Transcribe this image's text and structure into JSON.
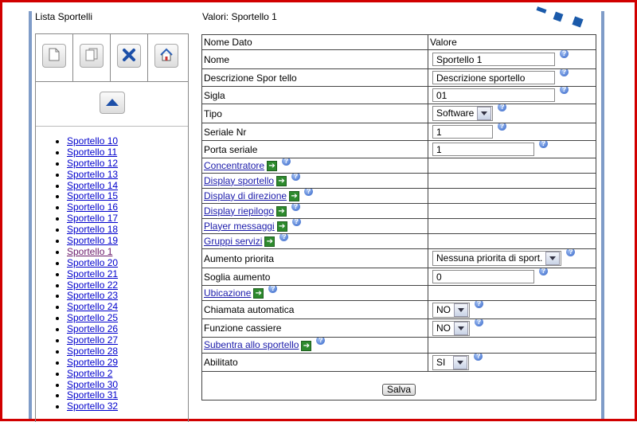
{
  "header": {
    "left_title": "Lista Sportelli",
    "right_title": "Valori: Sportello 1"
  },
  "toolbar": {
    "icons": [
      "new-document-icon",
      "copy-icon",
      "delete-icon",
      "home-icon"
    ]
  },
  "list": {
    "items": [
      "Sportello 10",
      "Sportello 11",
      "Sportello 12",
      "Sportello 13",
      "Sportello 14",
      "Sportello 15",
      "Sportello 16",
      "Sportello 17",
      "Sportello 18",
      "Sportello 19",
      "Sportello 1",
      "Sportello 20",
      "Sportello 21",
      "Sportello 22",
      "Sportello 23",
      "Sportello 24",
      "Sportello 25",
      "Sportello 26",
      "Sportello 27",
      "Sportello 28",
      "Sportello 29",
      "Sportello 2",
      "Sportello 30",
      "Sportello 31",
      "Sportello 32"
    ]
  },
  "table": {
    "col_name": "Nome Dato",
    "col_value": "Valore",
    "rows": {
      "nome": {
        "label": "Nome",
        "value": "Sportello 1"
      },
      "descrizione": {
        "label": "Descrizione Spor tello",
        "value": "Descrizione sportello"
      },
      "sigla": {
        "label": "Sigla",
        "value": "01"
      },
      "tipo": {
        "label": "Tipo",
        "value": "Software"
      },
      "seriale": {
        "label": "Seriale Nr",
        "value": "1"
      },
      "porta": {
        "label": "Porta seriale",
        "value": "1"
      },
      "concentratore": {
        "label": "Concentratore"
      },
      "display_sportello": {
        "label": "Display sportello"
      },
      "display_direzione": {
        "label": "Display di direzione"
      },
      "display_riepilogo": {
        "label": "Display riepilogo"
      },
      "player": {
        "label": "Player messaggi"
      },
      "gruppi": {
        "label": "Gruppi servizi"
      },
      "aumento": {
        "label": "Aumento priorita",
        "value": "Nessuna priorita di sport."
      },
      "soglia": {
        "label": "Soglia aumento",
        "value": "0"
      },
      "ubicazione": {
        "label": "Ubicazione"
      },
      "chiamata": {
        "label": "Chiamata automatica",
        "value": "NO"
      },
      "cassiere": {
        "label": "Funzione cassiere",
        "value": "NO"
      },
      "subentra": {
        "label": "Subentra allo sportello"
      },
      "abilitato": {
        "label": "Abilitato",
        "value": "SI"
      }
    },
    "save_label": "Salva"
  },
  "colors": {
    "frame": "#d10000",
    "accent_bar": "#7f9cc8",
    "link": "#0000cc",
    "logo": "#1a5aaa"
  }
}
